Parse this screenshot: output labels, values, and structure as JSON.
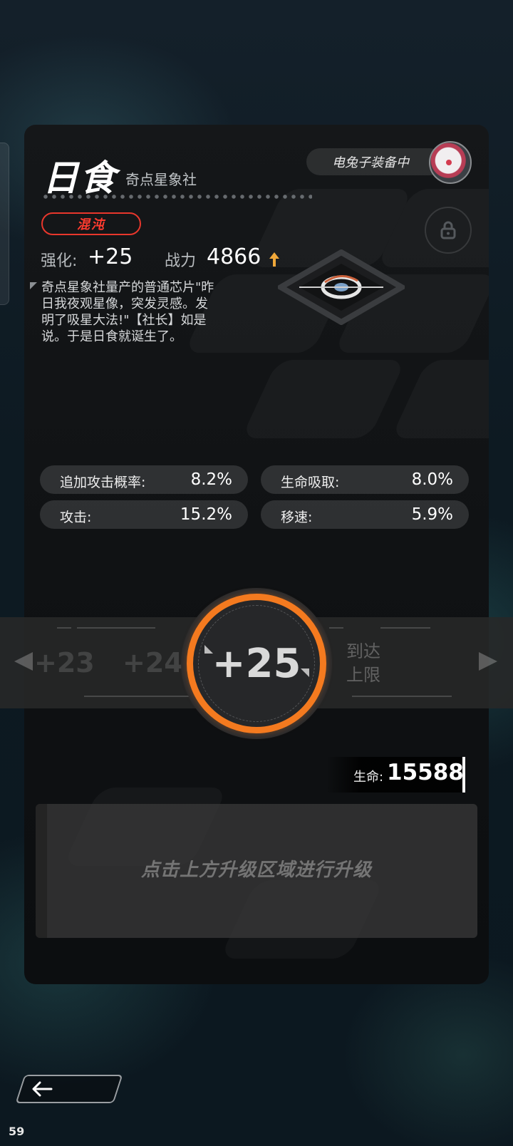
{
  "item": {
    "name": "日食",
    "faction": "奇点星象社",
    "rarity": "混沌",
    "equipped_by": "电兔子装备中",
    "enhance_label": "强化:",
    "enhance_value": "+25",
    "power_label": "战力",
    "power_value": "4866",
    "description": "奇点星象社量产的普通芯片\"昨日我夜观星像，突发灵感。发明了吸星大法!\"【社长】如是说。于是日食就诞生了。"
  },
  "stats": [
    {
      "key": "追加攻击概率:",
      "value": "8.2%"
    },
    {
      "key": "生命吸取:",
      "value": "8.0%"
    },
    {
      "key": "攻击:",
      "value": "15.2%"
    },
    {
      "key": "移速:",
      "value": "5.9%"
    }
  ],
  "selector": {
    "prev2": "+23",
    "prev1": "+24",
    "current": "+25",
    "next_line1": "到达",
    "next_line2": "上限"
  },
  "hp": {
    "label": "生命:",
    "value": "15588"
  },
  "upgrade_hint": "点击上方升级区域进行升级",
  "fps": "59",
  "icons": [
    "lock-icon",
    "up-arrow-icon",
    "back-arrow-icon",
    "chip-emblem-icon",
    "avatar-portrait"
  ],
  "colors": {
    "accent_orange": "#f47a1f",
    "rarity_red": "#e8372c",
    "arrow_yellow": "#f0a83a"
  }
}
